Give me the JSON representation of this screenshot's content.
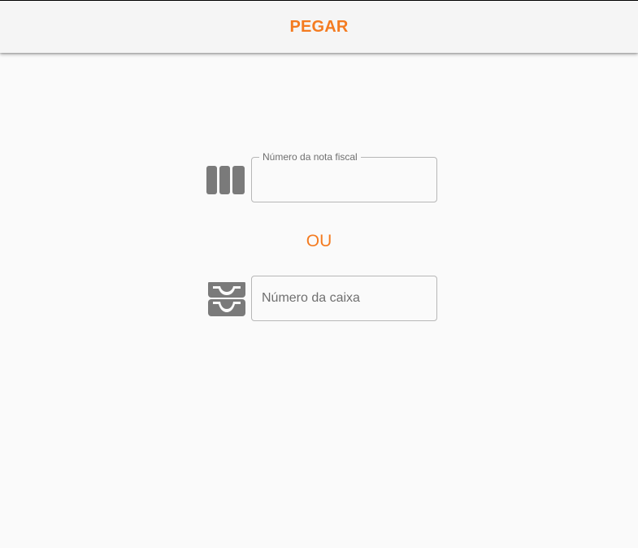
{
  "app_bar": {
    "title": "PEGAR"
  },
  "invoice_field": {
    "label": "Número da nota fiscal",
    "value": "",
    "icon": "barcode-icon"
  },
  "separator": {
    "text": "OU"
  },
  "box_field": {
    "placeholder": "Número da caixa",
    "value": "",
    "icon": "inbox-tray-icon"
  },
  "colors": {
    "accent": "#f47b20",
    "icon": "#7a7a7a",
    "background": "#fafafa",
    "app_bar": "#f5f5f5"
  }
}
